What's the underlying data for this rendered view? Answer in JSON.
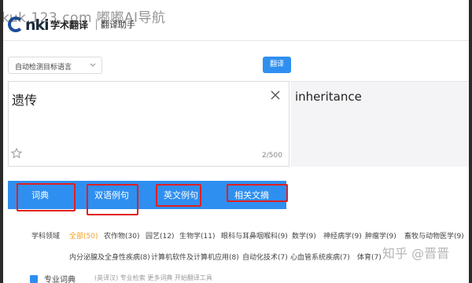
{
  "watermark_top": "kuk.123.com 嘟嘟AI导航",
  "header": {
    "logo_text": "nki",
    "brand": "学术翻译",
    "brand_sub": "翻译助手"
  },
  "lang_select": {
    "label": "自动检测目标语言"
  },
  "translate_button": "翻译",
  "input": {
    "text": "遗传",
    "char_count": "2/500"
  },
  "output": {
    "text": "inheritance"
  },
  "tabs": [
    {
      "label": "词典"
    },
    {
      "label": "双语例句"
    },
    {
      "label": "英文例句"
    },
    {
      "label": "相关文摘"
    }
  ],
  "filters": {
    "row1": [
      "学科领域",
      "全部(50)",
      "农作物(30)",
      "园艺(12)",
      "生物学(11)",
      "眼科与耳鼻咽喉科(9)",
      "数学(9)",
      "神经病学(9)",
      "肿瘤学(9)",
      "畜牧与动物医学(9)"
    ],
    "row2": [
      "内分泌腺及全身性疾病(8)",
      "计算机软件及计算机应用(8)",
      "自动化技术(7)",
      "心血管系统疾病(7)",
      "体育(7)"
    ]
  },
  "bottom": {
    "label": "专业词典",
    "gray": "(英译汉)  专业检索  更多词典  开始翻译工具"
  },
  "watermark_bottom": "知乎 @晋晋",
  "colors": {
    "accent": "#2f8ff0",
    "highlight": "#e02020",
    "active_filter": "#f0a020"
  }
}
